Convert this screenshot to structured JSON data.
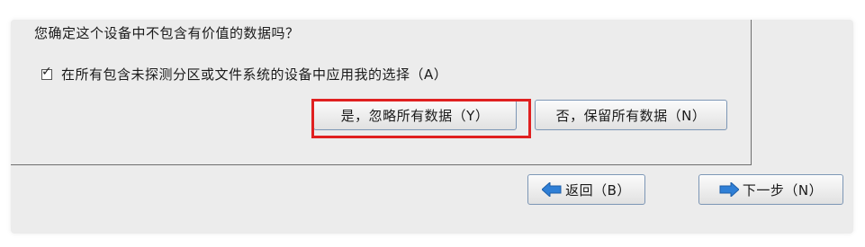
{
  "dialog": {
    "question": "您确定这个设备中不包含有价值的数据吗？",
    "apply_all_checkbox": {
      "checked": true,
      "label": "在所有包含未探测分区或文件系统的设备中应用我的选择（A）"
    },
    "yes_button_label": "是，忽略所有数据（Y）",
    "no_button_label": "否，保留所有数据（N）"
  },
  "nav": {
    "back_label": "返回（B）",
    "next_label": "下一步（N）"
  },
  "colors": {
    "highlight": "#e02020",
    "arrow_blue": "#2f7fd6",
    "button_border": "#7c96b5"
  }
}
